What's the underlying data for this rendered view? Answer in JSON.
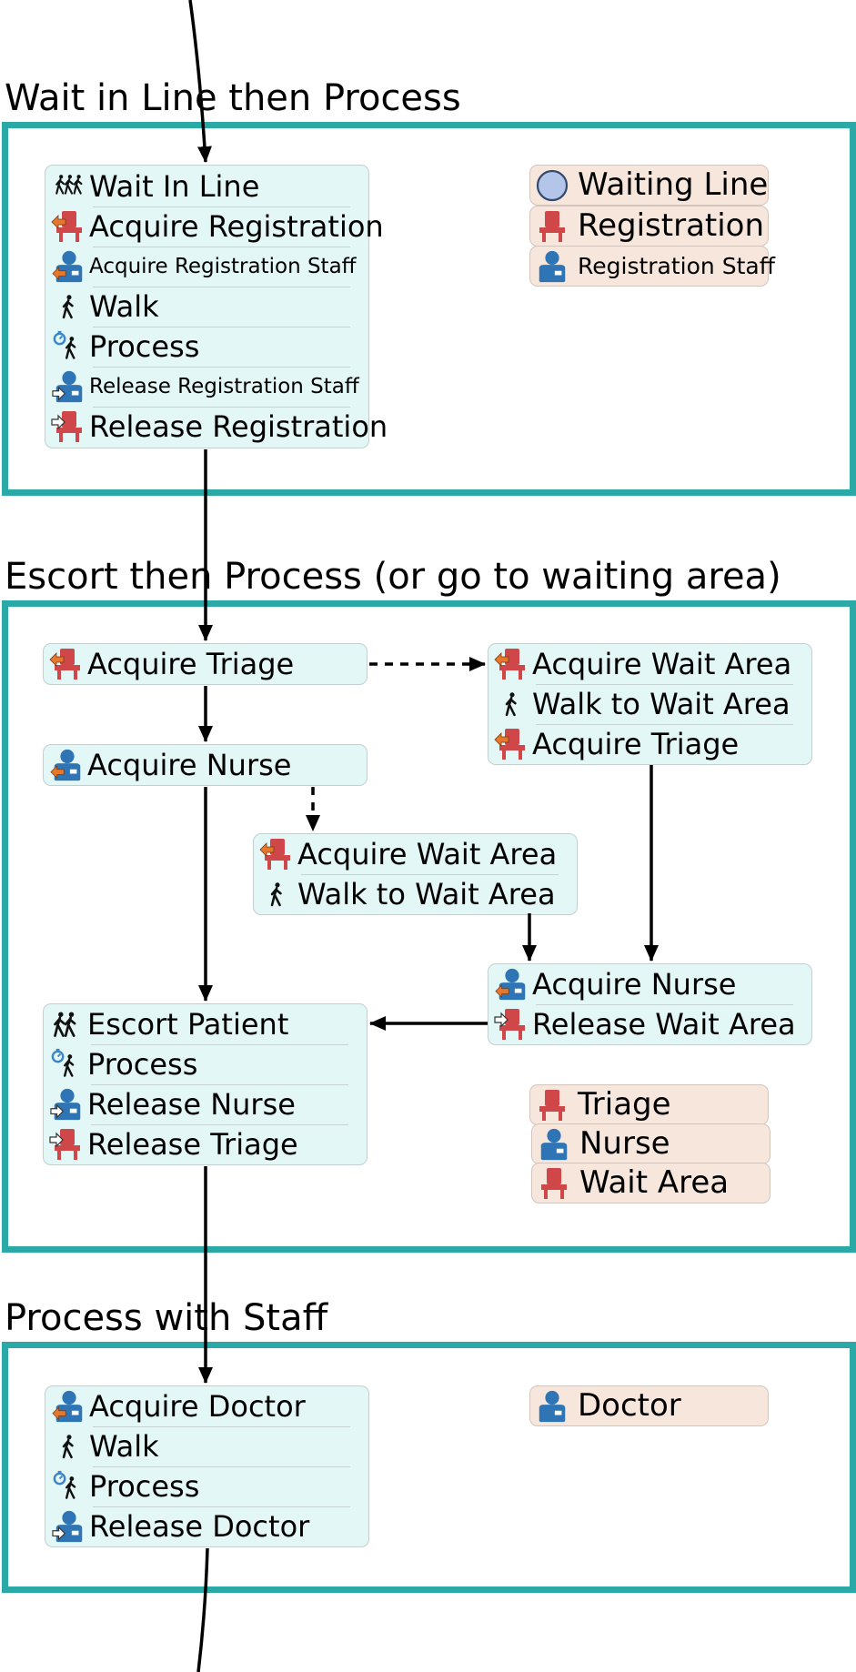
{
  "containers": [
    {
      "title": "Wait in Line then Process",
      "activity_blocks": [
        {
          "activities": [
            {
              "label": "Wait In Line",
              "icon": "wait-in-line-icon"
            },
            {
              "label": "Acquire Registration",
              "icon": "acquire-location-icon"
            },
            {
              "label": "Acquire Registration Staff",
              "icon": "acquire-staff-icon"
            },
            {
              "label": "Walk",
              "icon": "walk-icon"
            },
            {
              "label": "Process",
              "icon": "process-icon"
            },
            {
              "label": "Release Registration Staff",
              "icon": "release-staff-icon"
            },
            {
              "label": "Release Registration",
              "icon": "release-location-icon"
            }
          ]
        }
      ],
      "resources": [
        {
          "label": "Waiting Line",
          "icon": "waiting-line-icon"
        },
        {
          "label": "Registration",
          "icon": "location-icon"
        },
        {
          "label": "Registration Staff",
          "icon": "staff-icon"
        }
      ]
    },
    {
      "title": "Escort then Process (or go to waiting area)",
      "activity_blocks": [
        {
          "activities": [
            {
              "label": "Acquire Triage",
              "icon": "acquire-location-icon"
            }
          ]
        },
        {
          "activities": [
            {
              "label": "Acquire Nurse",
              "icon": "acquire-staff-icon"
            }
          ]
        },
        {
          "activities": [
            {
              "label": "Acquire Wait Area",
              "icon": "acquire-location-icon"
            },
            {
              "label": "Walk to Wait Area",
              "icon": "walk-icon"
            },
            {
              "label": "Acquire Triage",
              "icon": "acquire-location-icon"
            }
          ]
        },
        {
          "activities": [
            {
              "label": "Acquire Wait Area",
              "icon": "acquire-location-icon"
            },
            {
              "label": "Walk to Wait Area",
              "icon": "walk-icon"
            }
          ]
        },
        {
          "activities": [
            {
              "label": "Acquire Nurse",
              "icon": "acquire-staff-icon"
            },
            {
              "label": "Release Wait Area",
              "icon": "release-location-icon"
            }
          ]
        },
        {
          "activities": [
            {
              "label": "Escort Patient",
              "icon": "escort-icon"
            },
            {
              "label": "Process",
              "icon": "process-icon"
            },
            {
              "label": "Release Nurse",
              "icon": "release-staff-icon"
            },
            {
              "label": "Release Triage",
              "icon": "release-location-icon"
            }
          ]
        }
      ],
      "resources": [
        {
          "label": "Triage",
          "icon": "location-icon"
        },
        {
          "label": "Nurse",
          "icon": "staff-icon"
        },
        {
          "label": "Wait Area",
          "icon": "location-icon"
        }
      ]
    },
    {
      "title": "Process with Staff",
      "activity_blocks": [
        {
          "activities": [
            {
              "label": "Acquire Doctor",
              "icon": "acquire-staff-icon"
            },
            {
              "label": "Walk",
              "icon": "walk-icon"
            },
            {
              "label": "Process",
              "icon": "process-icon"
            },
            {
              "label": "Release Doctor",
              "icon": "release-staff-icon"
            }
          ]
        }
      ],
      "resources": [
        {
          "label": "Doctor",
          "icon": "staff-icon"
        }
      ]
    }
  ],
  "links": [
    {
      "from": "entry",
      "to": "Wait In Line",
      "style": "solid"
    },
    {
      "from": "Release Registration",
      "to": "Acquire Triage",
      "style": "solid"
    },
    {
      "from": "Acquire Triage",
      "to": "Acquire Nurse",
      "style": "solid"
    },
    {
      "from": "Acquire Triage",
      "to": "Acquire Wait Area (right)",
      "style": "dashed"
    },
    {
      "from": "Acquire Nurse",
      "to": "Acquire Wait Area (middle)",
      "style": "dashed"
    },
    {
      "from": "Acquire Nurse",
      "to": "Escort Patient",
      "style": "solid"
    },
    {
      "from": "Walk to Wait Area (middle)",
      "to": "Acquire Nurse (right)",
      "style": "solid"
    },
    {
      "from": "Acquire Triage (right)",
      "to": "Acquire Nurse (right)",
      "style": "solid"
    },
    {
      "from": "Release Wait Area",
      "to": "Escort Patient",
      "style": "solid"
    },
    {
      "from": "Release Triage",
      "to": "Acquire Doctor",
      "style": "solid"
    },
    {
      "from": "Release Doctor",
      "to": "exit",
      "style": "solid"
    }
  ],
  "colors": {
    "container_border": "#2aa9a7",
    "activity_fill": "#e2f7f6",
    "resource_fill": "#f7e6dc",
    "location_red": "#d0474a",
    "staff_blue": "#2f74b5",
    "acquire_orange": "#e8772e",
    "waiting_line_fill": "#b3c6ea"
  }
}
